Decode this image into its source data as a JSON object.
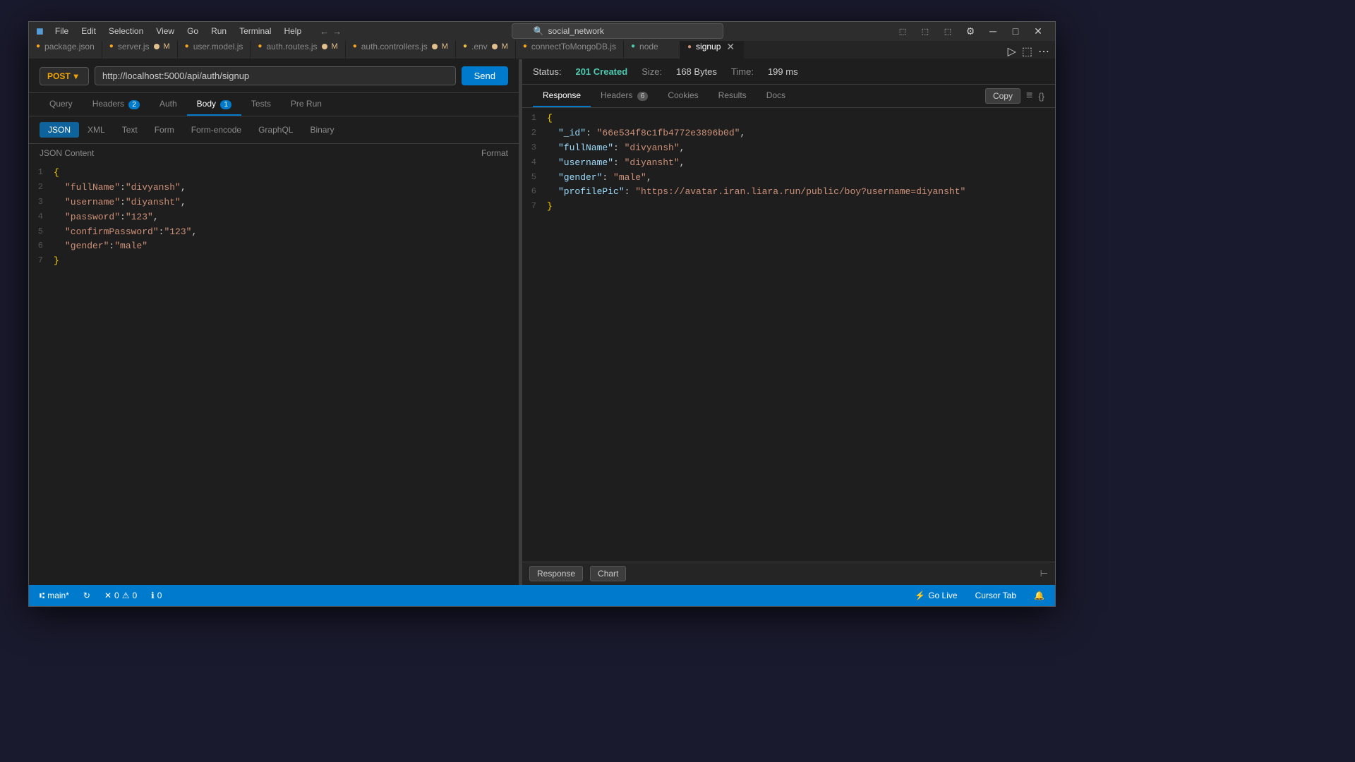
{
  "outer": {
    "bg_color": "#1a1a2e"
  },
  "titlebar": {
    "logo": "■",
    "menu_items": [
      "File",
      "Edit",
      "Selection",
      "View",
      "Go",
      "Run",
      "Terminal",
      "Help"
    ],
    "search_placeholder": "social_network",
    "nav_back": "←",
    "nav_forward": "→",
    "control_minimize": "─",
    "control_maximize": "□",
    "control_close": "✕"
  },
  "tabs": [
    {
      "id": "package",
      "label": "package.json",
      "icon_color": "#f5a623",
      "modified": false,
      "closeable": false
    },
    {
      "id": "server",
      "label": "server.js",
      "icon_color": "#f5a623",
      "modified": true,
      "badge": "M",
      "closeable": false
    },
    {
      "id": "user_model",
      "label": "user.model.js",
      "icon_color": "#f5a623",
      "modified": false,
      "closeable": false
    },
    {
      "id": "auth_routes",
      "label": "auth.routes.js",
      "icon_color": "#f5a623",
      "modified": true,
      "badge": "M",
      "closeable": false
    },
    {
      "id": "auth_controllers",
      "label": "auth.controllers.js",
      "icon_color": "#f5a623",
      "modified": true,
      "badge": "M",
      "closeable": false
    },
    {
      "id": "env",
      "label": ".env",
      "icon_color": "#f0c040",
      "modified": true,
      "badge": "M",
      "closeable": false
    },
    {
      "id": "connectToMongo",
      "label": "connectToMongoDB.js",
      "icon_color": "#f5a623",
      "modified": false,
      "closeable": false
    },
    {
      "id": "node",
      "label": "node",
      "icon_color": "#4ec9b0",
      "modified": false,
      "closeable": false
    },
    {
      "id": "signup",
      "label": "signup",
      "icon_color": "#ce9178",
      "modified": false,
      "active": true,
      "closeable": true
    }
  ],
  "request": {
    "method": "POST",
    "url": "http://localhost:5000/api/auth/signup",
    "send_label": "Send",
    "nav_tabs": [
      {
        "id": "query",
        "label": "Query"
      },
      {
        "id": "headers",
        "label": "Headers",
        "badge": "2"
      },
      {
        "id": "auth",
        "label": "Auth"
      },
      {
        "id": "body",
        "label": "Body",
        "badge": "1",
        "active": true
      },
      {
        "id": "tests",
        "label": "Tests"
      },
      {
        "id": "prerun",
        "label": "Pre Run"
      }
    ],
    "body_types": [
      "JSON",
      "XML",
      "Text",
      "Form",
      "Form-encode",
      "GraphQL",
      "Binary"
    ],
    "active_body_type": "JSON",
    "json_label": "JSON Content",
    "format_label": "Format",
    "json_body": [
      {
        "num": 1,
        "content": "{"
      },
      {
        "num": 2,
        "content": "\"fullName\":\"divyansh\","
      },
      {
        "num": 3,
        "content": "\"username\":\"diyansht\","
      },
      {
        "num": 4,
        "content": "\"password\":\"123\","
      },
      {
        "num": 5,
        "content": "\"confirmPassword\":\"123\","
      },
      {
        "num": 6,
        "content": "\"gender\":\"male\""
      },
      {
        "num": 7,
        "content": "}"
      }
    ]
  },
  "response": {
    "status_label": "Status:",
    "status_code": "201 Created",
    "size_label": "Size:",
    "size_value": "168 Bytes",
    "time_label": "Time:",
    "time_value": "199 ms",
    "nav_tabs": [
      {
        "id": "response",
        "label": "Response",
        "active": true
      },
      {
        "id": "headers",
        "label": "Headers",
        "badge": "6"
      },
      {
        "id": "cookies",
        "label": "Cookies"
      },
      {
        "id": "results",
        "label": "Results"
      },
      {
        "id": "docs",
        "label": "Docs"
      }
    ],
    "copy_label": "Copy",
    "json_lines": [
      {
        "num": 1,
        "content": "{"
      },
      {
        "num": 2,
        "key": "_id",
        "value": "66e534f8c1fb4772e3896b0d"
      },
      {
        "num": 3,
        "key": "fullName",
        "value": "divyansh"
      },
      {
        "num": 4,
        "key": "username",
        "value": "diyansht"
      },
      {
        "num": 5,
        "key": "gender",
        "value": "male"
      },
      {
        "num": 6,
        "key": "profilePic",
        "value": "https://avatar.iran.liara.run/public/boy?username=diyansht"
      },
      {
        "num": 7,
        "content": "}"
      }
    ],
    "bottom_buttons": [
      {
        "id": "response-btn",
        "label": "Response",
        "active": false
      },
      {
        "id": "chart-btn",
        "label": "Chart",
        "active": false
      }
    ]
  },
  "statusbar": {
    "branch": "main*",
    "sync_icon": "↻",
    "errors": "0",
    "warnings": "0",
    "info": "0",
    "go_live": "Go Live",
    "cursor_tab": "Cursor Tab",
    "bell_icon": "🔔"
  }
}
